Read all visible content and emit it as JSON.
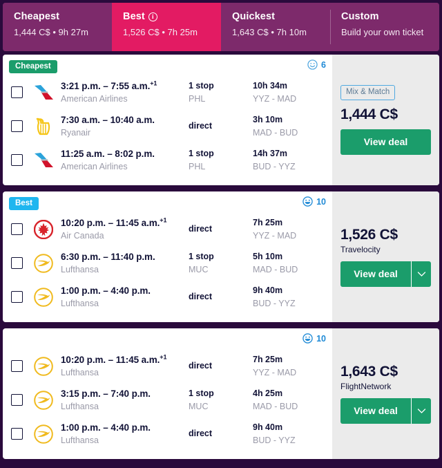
{
  "tabs": [
    {
      "title": "Cheapest",
      "subtitle": "1,444 C$ • 9h 27m",
      "active": false,
      "info": false
    },
    {
      "title": "Best",
      "subtitle": "1,526 C$ • 7h 25m",
      "active": true,
      "info": true
    },
    {
      "title": "Quickest",
      "subtitle": "1,643 C$ • 7h 10m",
      "active": false,
      "info": false
    },
    {
      "title": "Custom",
      "subtitle": "Build your own ticket",
      "active": false,
      "info": false
    }
  ],
  "cards": [
    {
      "tag": "Cheapest",
      "tag_kind": "cheapest",
      "score": "6",
      "score_face": "neutral-smiley-icon",
      "mix_match": "Mix & Match",
      "price": "1,444 C$",
      "provider": "",
      "deal_label": "View deal",
      "has_caret": false,
      "rows": [
        {
          "airline_logo": "american-airlines-logo",
          "time": "3:21 p.m. – 7:55 a.m.",
          "plus_days": "+1",
          "carrier": "American Airlines",
          "stops": "1 stop",
          "stops_sub": "PHL",
          "duration": "10h 34m",
          "route": "YYZ - MAD"
        },
        {
          "airline_logo": "ryanair-logo",
          "time": "7:30 a.m. – 10:40 a.m.",
          "plus_days": "",
          "carrier": "Ryanair",
          "stops": "direct",
          "stops_sub": "",
          "duration": "3h 10m",
          "route": "MAD - BUD"
        },
        {
          "airline_logo": "american-airlines-logo",
          "time": "11:25 a.m. – 8:02 p.m.",
          "plus_days": "",
          "carrier": "American Airlines",
          "stops": "1 stop",
          "stops_sub": "PHL",
          "duration": "14h 37m",
          "route": "BUD - YYZ"
        }
      ]
    },
    {
      "tag": "Best",
      "tag_kind": "best",
      "score": "10",
      "score_face": "grinning-smiley-icon",
      "mix_match": "",
      "price": "1,526 C$",
      "provider": "Travelocity",
      "deal_label": "View deal",
      "has_caret": true,
      "rows": [
        {
          "airline_logo": "air-canada-logo",
          "time": "10:20 p.m. – 11:45 a.m.",
          "plus_days": "+1",
          "carrier": "Air Canada",
          "stops": "direct",
          "stops_sub": "",
          "duration": "7h 25m",
          "route": "YYZ - MAD"
        },
        {
          "airline_logo": "lufthansa-logo",
          "time": "6:30 p.m. – 11:40 p.m.",
          "plus_days": "",
          "carrier": "Lufthansa",
          "stops": "1 stop",
          "stops_sub": "MUC",
          "duration": "5h 10m",
          "route": "MAD - BUD"
        },
        {
          "airline_logo": "lufthansa-logo",
          "time": "1:00 p.m. – 4:40 p.m.",
          "plus_days": "",
          "carrier": "Lufthansa",
          "stops": "direct",
          "stops_sub": "",
          "duration": "9h 40m",
          "route": "BUD - YYZ"
        }
      ]
    },
    {
      "tag": "",
      "tag_kind": "",
      "score": "10",
      "score_face": "grinning-smiley-icon",
      "mix_match": "",
      "price": "1,643 C$",
      "provider": "FlightNetwork",
      "deal_label": "View deal",
      "has_caret": true,
      "rows": [
        {
          "airline_logo": "lufthansa-logo",
          "time": "10:20 p.m. – 11:45 a.m.",
          "plus_days": "+1",
          "carrier": "Lufthansa",
          "stops": "direct",
          "stops_sub": "",
          "duration": "7h 25m",
          "route": "YYZ - MAD"
        },
        {
          "airline_logo": "lufthansa-logo",
          "time": "3:15 p.m. – 7:40 p.m.",
          "plus_days": "",
          "carrier": "Lufthansa",
          "stops": "1 stop",
          "stops_sub": "MUC",
          "duration": "4h 25m",
          "route": "MAD - BUD"
        },
        {
          "airline_logo": "lufthansa-logo",
          "time": "1:00 p.m. – 4:40 p.m.",
          "plus_days": "",
          "carrier": "Lufthansa",
          "stops": "direct",
          "stops_sub": "",
          "duration": "9h 40m",
          "route": "BUD - YYZ"
        }
      ]
    }
  ],
  "colors": {
    "page_bg": "#2a0a3c",
    "tabbar": "#7d2a6b",
    "tab_active": "#e31b63",
    "cheapest_badge": "#1b9d6b",
    "best_badge": "#1fb6ef",
    "deal_green": "#1b9d6b",
    "score_blue": "#1f8ad6"
  }
}
